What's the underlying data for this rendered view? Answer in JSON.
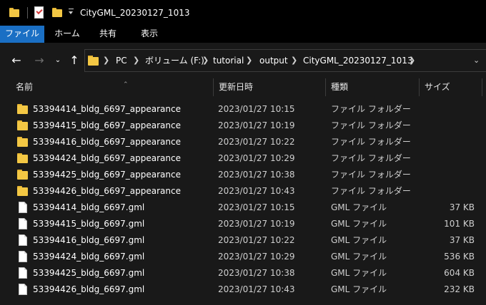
{
  "window": {
    "title": "CityGML_20230127_1013"
  },
  "ribbon": {
    "tabs": [
      {
        "label": "ファイル",
        "active": true
      },
      {
        "label": "ホーム",
        "active": false
      },
      {
        "label": "共有",
        "active": false
      },
      {
        "label": "表示",
        "active": false
      }
    ]
  },
  "address": {
    "breadcrumbs": [
      "PC",
      "ボリューム (F:)",
      "tutorial",
      "output",
      "CityGML_20230127_1013"
    ]
  },
  "columns": {
    "name": "名前",
    "date": "更新日時",
    "type": "種類",
    "size": "サイズ"
  },
  "files": [
    {
      "icon": "folder-icon",
      "name": "53394414_bldg_6697_appearance",
      "date": "2023/01/27 10:15",
      "type": "ファイル フォルダー",
      "size": ""
    },
    {
      "icon": "folder-icon",
      "name": "53394415_bldg_6697_appearance",
      "date": "2023/01/27 10:19",
      "type": "ファイル フォルダー",
      "size": ""
    },
    {
      "icon": "folder-icon",
      "name": "53394416_bldg_6697_appearance",
      "date": "2023/01/27 10:22",
      "type": "ファイル フォルダー",
      "size": ""
    },
    {
      "icon": "folder-icon",
      "name": "53394424_bldg_6697_appearance",
      "date": "2023/01/27 10:29",
      "type": "ファイル フォルダー",
      "size": ""
    },
    {
      "icon": "folder-icon",
      "name": "53394425_bldg_6697_appearance",
      "date": "2023/01/27 10:38",
      "type": "ファイル フォルダー",
      "size": ""
    },
    {
      "icon": "folder-icon",
      "name": "53394426_bldg_6697_appearance",
      "date": "2023/01/27 10:43",
      "type": "ファイル フォルダー",
      "size": ""
    },
    {
      "icon": "file-icon",
      "name": "53394414_bldg_6697.gml",
      "date": "2023/01/27 10:15",
      "type": "GML ファイル",
      "size": "37 KB"
    },
    {
      "icon": "file-icon",
      "name": "53394415_bldg_6697.gml",
      "date": "2023/01/27 10:19",
      "type": "GML ファイル",
      "size": "101 KB"
    },
    {
      "icon": "file-icon",
      "name": "53394416_bldg_6697.gml",
      "date": "2023/01/27 10:22",
      "type": "GML ファイル",
      "size": "37 KB"
    },
    {
      "icon": "file-icon",
      "name": "53394424_bldg_6697.gml",
      "date": "2023/01/27 10:29",
      "type": "GML ファイル",
      "size": "536 KB"
    },
    {
      "icon": "file-icon",
      "name": "53394425_bldg_6697.gml",
      "date": "2023/01/27 10:38",
      "type": "GML ファイル",
      "size": "604 KB"
    },
    {
      "icon": "file-icon",
      "name": "53394426_bldg_6697.gml",
      "date": "2023/01/27 10:43",
      "type": "GML ファイル",
      "size": "232 KB"
    }
  ],
  "colors": {
    "background": "#191919",
    "titlebar": "#000000",
    "accent": "#1a6fc4",
    "folder": "#f3c744"
  }
}
